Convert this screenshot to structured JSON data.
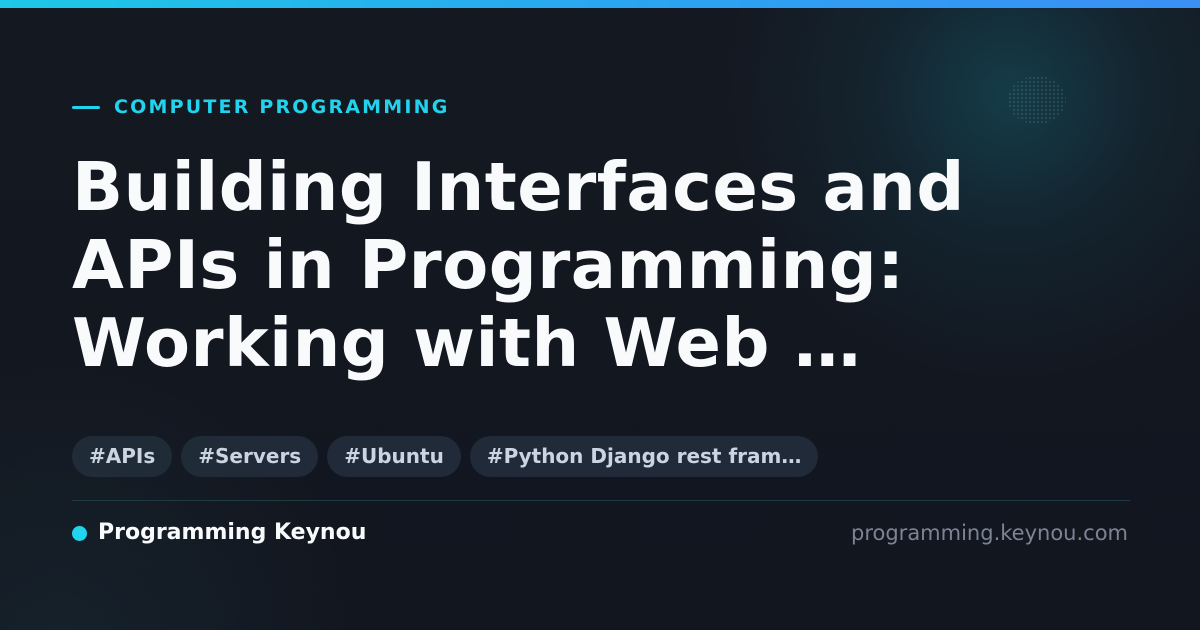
{
  "category": "COMPUTER PROGRAMMING",
  "title": "Building Interfaces and\nAPIs in Programming:\nWorking with Web …",
  "tags": [
    "#APIs",
    "#Servers",
    "#Ubuntu",
    "#Python Django rest fram…"
  ],
  "footer": {
    "brand": "Programming Keynou",
    "domain": "programming.keynou.com"
  },
  "colors": {
    "accent": "#22d3ee",
    "background": "#12161f",
    "title_text": "#f8fafc",
    "tag_background": "#263240",
    "tag_text": "#cbd5e1",
    "muted_text": "#7b8494"
  }
}
